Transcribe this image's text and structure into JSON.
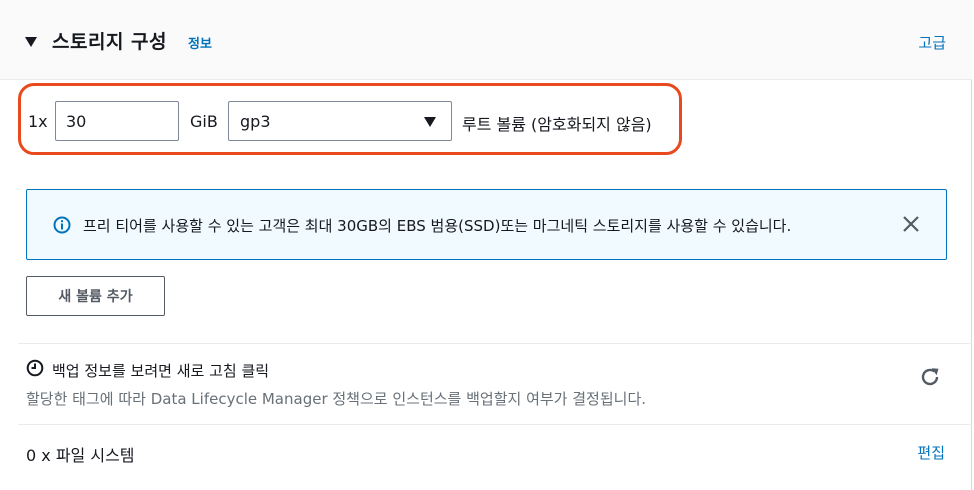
{
  "section": {
    "title": "스토리지 구성",
    "info_link": "정보",
    "advanced_link": "고급"
  },
  "volume": {
    "count_label": "1x",
    "size_value": "30",
    "unit": "GiB",
    "type_selected": "gp3",
    "root_label": "루트 볼륨  (암호화되지 않음)"
  },
  "alert": {
    "text": "프리 티어를 사용할 수 있는 고객은 최대 30GB의 EBS 범용(SSD)또는 마그네틱 스토리지를 사용할 수 있습니다."
  },
  "buttons": {
    "add_volume": "새 볼륨 추가"
  },
  "backup": {
    "title": "백업 정보를 보려면 새로 고침 클릭",
    "description": "할당한 태그에 따라 Data Lifecycle Manager 정책으로 인스턴스를 백업할지 여부가 결정됩니다."
  },
  "filesystems": {
    "label": "0 x 파일 시스템",
    "edit_link": "편집"
  },
  "colors": {
    "link": "#0073bb",
    "highlight": "#e8491d",
    "alert_bg": "#f1faff",
    "alert_border": "#0073bb"
  },
  "icons": {
    "caret": "caret-down-icon",
    "alert": "info-icon",
    "close": "close-icon",
    "backup": "clock-icon",
    "refresh": "refresh-icon",
    "select": "triangle-down-icon"
  }
}
